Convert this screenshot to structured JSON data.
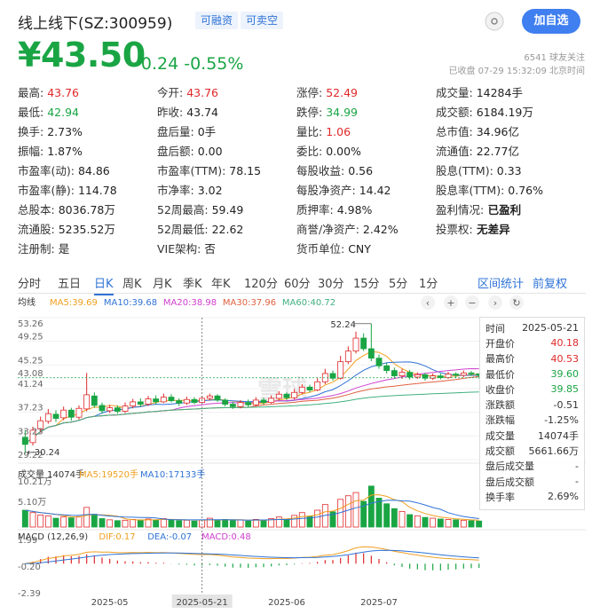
{
  "header": {
    "title": "线上线下(SZ:300959)",
    "tag_margin": "可融资",
    "tag_short": "可卖空",
    "follow_button": "加自选",
    "followers": "6541 球友关注",
    "status": "已收盘 07-29 15:32:09 北京时间"
  },
  "quote": {
    "price": "¥43.50",
    "change": "-0.24",
    "change_pct": "-0.55%"
  },
  "stats": [
    [
      {
        "k": "最高:",
        "v": "43.76",
        "c": "red"
      },
      {
        "k": "今开:",
        "v": "43.76",
        "c": "red"
      },
      {
        "k": "涨停:",
        "v": "52.49",
        "c": "red"
      },
      {
        "k": "成交量:",
        "v": "14284手",
        "c": ""
      }
    ],
    [
      {
        "k": "最低:",
        "v": "42.94",
        "c": "green"
      },
      {
        "k": "昨收:",
        "v": "43.74",
        "c": ""
      },
      {
        "k": "跌停:",
        "v": "34.99",
        "c": "green"
      },
      {
        "k": "成交额:",
        "v": "6184.19万",
        "c": ""
      }
    ],
    [
      {
        "k": "换手:",
        "v": "2.73%",
        "c": ""
      },
      {
        "k": "盘后量:",
        "v": "0手",
        "c": ""
      },
      {
        "k": "量比:",
        "v": "1.06",
        "c": "red"
      },
      {
        "k": "总市值:",
        "v": "34.96亿",
        "c": ""
      }
    ],
    [
      {
        "k": "振幅:",
        "v": "1.87%",
        "c": ""
      },
      {
        "k": "盘后额:",
        "v": "0.00",
        "c": ""
      },
      {
        "k": "委比:",
        "v": "0.00%",
        "c": ""
      },
      {
        "k": "流通值:",
        "v": "22.77亿",
        "c": ""
      }
    ],
    [
      {
        "k": "市盈率(动):",
        "v": "84.86",
        "c": ""
      },
      {
        "k": "市盈率(TTM):",
        "v": "78.15",
        "c": ""
      },
      {
        "k": "每股收益:",
        "v": "0.56",
        "c": ""
      },
      {
        "k": "股息(TTM):",
        "v": "0.33",
        "c": ""
      }
    ],
    [
      {
        "k": "市盈率(静):",
        "v": "114.78",
        "c": ""
      },
      {
        "k": "市净率:",
        "v": "3.02",
        "c": ""
      },
      {
        "k": "每股净资产:",
        "v": "14.42",
        "c": ""
      },
      {
        "k": "股息率(TTM):",
        "v": "0.76%",
        "c": ""
      }
    ],
    [
      {
        "k": "总股本:",
        "v": "8036.78万",
        "c": ""
      },
      {
        "k": "52周最高:",
        "v": "59.49",
        "c": ""
      },
      {
        "k": "质押率:",
        "v": "4.98%",
        "c": ""
      },
      {
        "k": "盈利情况:",
        "v": "已盈利",
        "c": "bold"
      }
    ],
    [
      {
        "k": "流通股:",
        "v": "5235.52万",
        "c": ""
      },
      {
        "k": "52周最低:",
        "v": "22.62",
        "c": ""
      },
      {
        "k": "商誉/净资产:",
        "v": "2.42%",
        "c": ""
      },
      {
        "k": "投票权:",
        "v": "无差异",
        "c": "bold"
      }
    ],
    [
      {
        "k": "注册制:",
        "v": "是",
        "c": ""
      },
      {
        "k": "VIE架构:",
        "v": "否",
        "c": ""
      },
      {
        "k": "货币单位:",
        "v": "CNY",
        "c": ""
      },
      {
        "k": "",
        "v": "",
        "c": ""
      }
    ]
  ],
  "tabs": [
    "分时",
    "五日",
    "日K",
    "周K",
    "月K",
    "季K",
    "年K",
    "120分",
    "60分",
    "30分",
    "15分",
    "5分",
    "1分"
  ],
  "active_tab": "日K",
  "tab_right": [
    "区间统计",
    "前复权"
  ],
  "chart_data": [
    {
      "type": "candlestick",
      "legend_label": "均线",
      "legend": [
        {
          "label": "MA5:39.69",
          "color": "#f0a020"
        },
        {
          "label": "MA10:39.68",
          "color": "#2f73d6"
        },
        {
          "label": "MA20:38.98",
          "color": "#d040d0"
        },
        {
          "label": "MA30:37.96",
          "color": "#e06040"
        },
        {
          "label": "MA60:40.72",
          "color": "#40b080"
        }
      ],
      "y_ticks": [
        "53.26",
        "49.25",
        "45.25",
        "43.08",
        "41.24",
        "37.23",
        "33.23",
        "29.22"
      ],
      "ylim": [
        29.22,
        53.26
      ],
      "annotations": {
        "max": "52.24",
        "min": "30.24"
      },
      "last_price_line": 43.08,
      "candles": [
        {
          "o": 33.0,
          "c": 31.8,
          "h": 34.2,
          "l": 30.24
        },
        {
          "o": 32.1,
          "c": 34.2,
          "h": 34.8,
          "l": 31.6
        },
        {
          "o": 34.4,
          "c": 35.8,
          "h": 36.5,
          "l": 33.8
        },
        {
          "o": 35.7,
          "c": 37.0,
          "h": 37.8,
          "l": 35.3
        },
        {
          "o": 36.9,
          "c": 36.2,
          "h": 37.6,
          "l": 35.6
        },
        {
          "o": 36.3,
          "c": 37.6,
          "h": 38.2,
          "l": 35.9
        },
        {
          "o": 37.6,
          "c": 36.4,
          "h": 38.0,
          "l": 35.8
        },
        {
          "o": 36.4,
          "c": 37.9,
          "h": 38.4,
          "l": 36.0
        },
        {
          "o": 37.8,
          "c": 40.2,
          "h": 43.9,
          "l": 37.4
        },
        {
          "o": 40.0,
          "c": 38.4,
          "h": 40.6,
          "l": 38.0
        },
        {
          "o": 38.4,
          "c": 37.5,
          "h": 38.9,
          "l": 37.0
        },
        {
          "o": 37.5,
          "c": 38.0,
          "h": 38.5,
          "l": 37.1
        },
        {
          "o": 38.0,
          "c": 37.4,
          "h": 38.4,
          "l": 37.0
        },
        {
          "o": 37.4,
          "c": 38.3,
          "h": 38.9,
          "l": 37.1
        },
        {
          "o": 38.3,
          "c": 39.0,
          "h": 39.5,
          "l": 37.9
        },
        {
          "o": 39.0,
          "c": 38.6,
          "h": 39.6,
          "l": 38.2
        },
        {
          "o": 38.6,
          "c": 39.5,
          "h": 40.0,
          "l": 38.3
        },
        {
          "o": 39.5,
          "c": 39.0,
          "h": 40.1,
          "l": 38.6
        },
        {
          "o": 39.0,
          "c": 39.8,
          "h": 40.4,
          "l": 38.8
        },
        {
          "o": 39.8,
          "c": 39.2,
          "h": 40.3,
          "l": 38.9
        },
        {
          "o": 39.2,
          "c": 38.8,
          "h": 39.6,
          "l": 38.3
        },
        {
          "o": 38.8,
          "c": 39.4,
          "h": 39.9,
          "l": 38.5
        },
        {
          "o": 39.4,
          "c": 38.9,
          "h": 39.8,
          "l": 38.6
        },
        {
          "o": 38.9,
          "c": 39.6,
          "h": 40.0,
          "l": 38.7
        },
        {
          "o": 39.6,
          "c": 40.0,
          "h": 40.4,
          "l": 39.2
        },
        {
          "o": 40.0,
          "c": 39.3,
          "h": 40.3,
          "l": 39.0
        },
        {
          "o": 39.3,
          "c": 38.6,
          "h": 39.6,
          "l": 38.2
        },
        {
          "o": 38.6,
          "c": 38.2,
          "h": 39.0,
          "l": 37.8
        },
        {
          "o": 38.2,
          "c": 38.9,
          "h": 39.3,
          "l": 37.9
        },
        {
          "o": 38.9,
          "c": 38.5,
          "h": 39.4,
          "l": 38.1
        },
        {
          "o": 38.5,
          "c": 39.3,
          "h": 39.8,
          "l": 38.2
        },
        {
          "o": 39.3,
          "c": 38.9,
          "h": 39.7,
          "l": 38.5
        },
        {
          "o": 38.9,
          "c": 39.6,
          "h": 40.1,
          "l": 38.7
        },
        {
          "o": 39.6,
          "c": 40.3,
          "h": 40.8,
          "l": 39.3
        },
        {
          "o": 40.3,
          "c": 39.7,
          "h": 40.6,
          "l": 39.3
        },
        {
          "o": 39.7,
          "c": 40.6,
          "h": 41.2,
          "l": 39.4
        },
        {
          "o": 40.6,
          "c": 41.5,
          "h": 42.0,
          "l": 40.3
        },
        {
          "o": 41.5,
          "c": 41.0,
          "h": 41.9,
          "l": 40.6
        },
        {
          "o": 41.0,
          "c": 42.4,
          "h": 43.0,
          "l": 40.8
        },
        {
          "o": 42.4,
          "c": 43.8,
          "h": 44.6,
          "l": 42.0
        },
        {
          "o": 43.8,
          "c": 43.0,
          "h": 44.3,
          "l": 42.6
        },
        {
          "o": 43.0,
          "c": 45.8,
          "h": 46.8,
          "l": 42.8
        },
        {
          "o": 45.8,
          "c": 47.6,
          "h": 48.4,
          "l": 45.4
        },
        {
          "o": 47.6,
          "c": 49.8,
          "h": 50.9,
          "l": 47.2
        },
        {
          "o": 49.8,
          "c": 48.0,
          "h": 50.6,
          "l": 47.6
        },
        {
          "o": 48.0,
          "c": 46.4,
          "h": 52.24,
          "l": 45.9
        },
        {
          "o": 46.4,
          "c": 45.1,
          "h": 47.0,
          "l": 44.6
        },
        {
          "o": 45.1,
          "c": 44.3,
          "h": 45.6,
          "l": 43.8
        },
        {
          "o": 44.3,
          "c": 43.4,
          "h": 44.8,
          "l": 43.0
        },
        {
          "o": 43.4,
          "c": 44.0,
          "h": 44.6,
          "l": 42.9
        },
        {
          "o": 44.0,
          "c": 43.2,
          "h": 44.4,
          "l": 42.8
        },
        {
          "o": 43.2,
          "c": 43.6,
          "h": 44.0,
          "l": 42.9
        },
        {
          "o": 43.6,
          "c": 43.0,
          "h": 43.9,
          "l": 42.6
        },
        {
          "o": 43.0,
          "c": 43.4,
          "h": 43.8,
          "l": 42.7
        },
        {
          "o": 43.4,
          "c": 43.1,
          "h": 43.8,
          "l": 42.8
        },
        {
          "o": 43.1,
          "c": 43.7,
          "h": 44.1,
          "l": 42.9
        },
        {
          "o": 43.7,
          "c": 43.5,
          "h": 44.0,
          "l": 43.1
        },
        {
          "o": 43.5,
          "c": 43.9,
          "h": 44.3,
          "l": 43.2
        },
        {
          "o": 43.9,
          "c": 43.74,
          "h": 44.2,
          "l": 43.4
        },
        {
          "o": 43.76,
          "c": 43.5,
          "h": 43.76,
          "l": 42.94
        }
      ]
    },
    {
      "type": "bar",
      "legend": [
        {
          "label": "成交量 14074手",
          "color": "#333"
        },
        {
          "label": "MA5:19520手",
          "color": "#f0a020"
        },
        {
          "label": "MA10:17133手",
          "color": "#2f73d6"
        }
      ],
      "y_ticks": [
        "10.21万",
        "5.10万"
      ],
      "ylim": [
        0,
        11.5
      ],
      "unit": "万手",
      "values": [
        4.2,
        3.6,
        3.0,
        2.8,
        2.2,
        2.5,
        2.3,
        2.6,
        4.9,
        3.2,
        2.1,
        1.8,
        1.6,
        1.7,
        1.9,
        1.8,
        2.0,
        1.7,
        2.1,
        1.9,
        1.6,
        1.7,
        1.5,
        1.8,
        2.2,
        1.7,
        1.9,
        1.6,
        1.8,
        1.5,
        1.9,
        1.7,
        2.1,
        2.5,
        2.0,
        2.9,
        3.6,
        2.7,
        4.2,
        5.6,
        3.8,
        6.9,
        7.8,
        8.6,
        6.4,
        10.21,
        7.2,
        5.8,
        4.6,
        3.9,
        3.1,
        2.8,
        2.4,
        2.2,
        2.0,
        1.9,
        1.8,
        1.7,
        1.6,
        1.5
      ]
    },
    {
      "type": "line",
      "legend": [
        {
          "label": "MACD (12,26,9)",
          "color": "#333"
        },
        {
          "label": "DIF:0.17",
          "color": "#f0a020"
        },
        {
          "label": "DEA:-0.07",
          "color": "#2f73d6"
        },
        {
          "label": "MACD:0.48",
          "color": "#d040d0"
        }
      ],
      "y_ticks": [
        "1.99",
        "-0.20",
        "-2.39"
      ],
      "ylim": [
        -2.39,
        1.99
      ]
    }
  ],
  "x_axis": [
    "2025-05",
    "2025-05-21",
    "2025-06",
    "2025-07"
  ],
  "crosshair_date": "2025-05-21",
  "tooltip": [
    {
      "k": "时间",
      "v": "2025-05-21",
      "c": ""
    },
    {
      "k": "开盘价",
      "v": "40.18",
      "c": "red"
    },
    {
      "k": "最高价",
      "v": "40.53",
      "c": "red"
    },
    {
      "k": "最低价",
      "v": "39.60",
      "c": "green"
    },
    {
      "k": "收盘价",
      "v": "39.85",
      "c": "green"
    },
    {
      "k": "涨跌额",
      "v": "-0.51",
      "c": ""
    },
    {
      "k": "涨跌幅",
      "v": "-1.25%",
      "c": ""
    },
    {
      "k": "成交量",
      "v": "14074手",
      "c": ""
    },
    {
      "k": "成交额",
      "v": "5661.66万",
      "c": ""
    },
    {
      "k": "盘后成交量",
      "v": "-",
      "c": ""
    },
    {
      "k": "盘后成交额",
      "v": "-",
      "c": ""
    },
    {
      "k": "换手率",
      "v": "2.69%",
      "c": ""
    }
  ],
  "watermark": "雪球",
  "icons": [
    "chevron-left-icon",
    "plus-icon",
    "minus-icon",
    "chevron-right-icon",
    "refresh-icon"
  ],
  "colors": {
    "up": "#e0282a",
    "down": "#1aa544",
    "accent": "#2f73d6"
  }
}
